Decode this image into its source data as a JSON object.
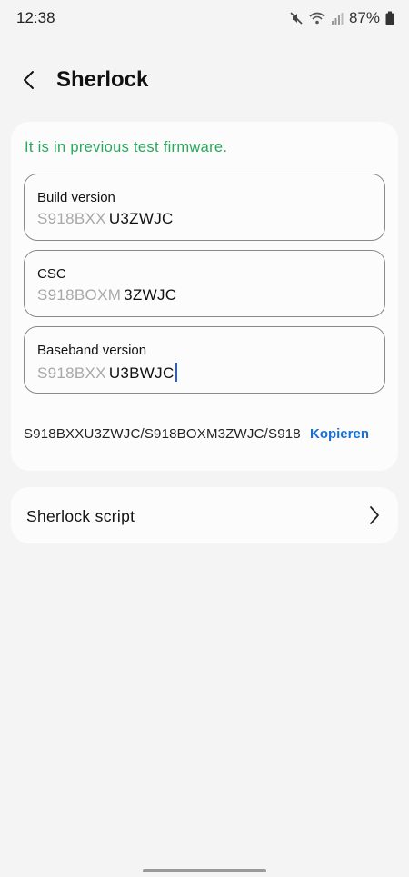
{
  "status_bar": {
    "time": "12:38",
    "battery": "87%",
    "icons": [
      "mute-icon",
      "wifi-icon",
      "signal-icon",
      "battery-icon"
    ]
  },
  "header": {
    "title": "Sherlock",
    "back_icon": "back-arrow-icon"
  },
  "main": {
    "notice": "It is in previous test firmware.",
    "notice_color": "#27a85c",
    "fields": [
      {
        "label": "Build version",
        "prefix": "S918BXX",
        "value": "U3ZWJC"
      },
      {
        "label": "CSC",
        "prefix": "S918BOXM",
        "value": "3ZWJC"
      },
      {
        "label": "Baseband version",
        "prefix": "S918BXX",
        "value": "U3BWJC"
      }
    ],
    "combined": "S918BXXU3ZWJC/S918BOXM3ZWJC/S918",
    "copy_label": "Kopieren",
    "accent_color": "#1a6fd0"
  },
  "script_item": {
    "label": "Sherlock script",
    "icon": "chevron-right-icon"
  }
}
